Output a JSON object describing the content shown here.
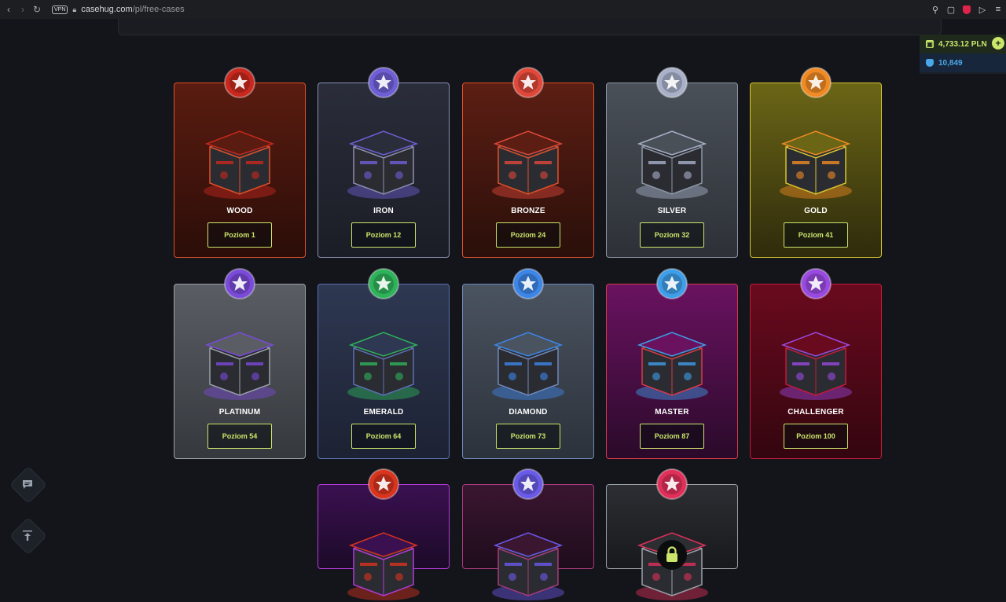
{
  "browser": {
    "vpn_label": "VPN",
    "url_domain": "casehug.com",
    "url_path": "/pl/free-cases"
  },
  "balance": {
    "money": "4,733.12 PLN",
    "points": "10,849",
    "money_icon": "wallet-icon",
    "points_icon": "shield-icon"
  },
  "cases": [
    {
      "name": "WOOD",
      "button": "Poziom 1",
      "border": "#e0502a",
      "bg1": "#5a1c10",
      "bg2": "#2b0d08",
      "medal": "#c8281e"
    },
    {
      "name": "IRON",
      "button": "Poziom 12",
      "border": "#8b8fb0",
      "bg1": "#2a2d3a",
      "bg2": "#1b1d26",
      "medal": "#6e5fd6"
    },
    {
      "name": "BRONZE",
      "button": "Poziom 24",
      "border": "#e0502a",
      "bg1": "#5c1e13",
      "bg2": "#2a0f0a",
      "medal": "#e0483a"
    },
    {
      "name": "SILVER",
      "button": "Poziom 32",
      "border": "#8f96a4",
      "bg1": "#4a5058",
      "bg2": "#2d3137",
      "medal": "#a9b1c9"
    },
    {
      "name": "GOLD",
      "button": "Poziom 41",
      "border": "#d6c32e",
      "bg1": "#6b6616",
      "bg2": "#2f2b0c",
      "medal": "#f08a24"
    },
    {
      "name": "PLATINUM",
      "button": "Poziom 54",
      "border": "#9aa0a8",
      "bg1": "#5a5e64",
      "bg2": "#35383d",
      "medal": "#7a4ad8"
    },
    {
      "name": "EMERALD",
      "button": "Poziom 64",
      "border": "#5d6fb5",
      "bg1": "#2e3852",
      "bg2": "#1d2233",
      "medal": "#2fb35a"
    },
    {
      "name": "DIAMOND",
      "button": "Poziom 73",
      "border": "#6f88b8",
      "bg1": "#4a5360",
      "bg2": "#2c323b",
      "medal": "#3d86e8"
    },
    {
      "name": "MASTER",
      "button": "Poziom 87",
      "border": "#d83a48",
      "bg1": "#6a1260",
      "bg2": "#2a0a2a",
      "medal": "#3f9ee8"
    },
    {
      "name": "CHALLENGER",
      "button": "Poziom 100",
      "border": "#c21a3a",
      "bg1": "#6a0a1e",
      "bg2": "#33060f",
      "medal": "#9a4ae0"
    },
    {
      "name": "",
      "button": "",
      "border": "#b23ad8",
      "bg1": "#3a1050",
      "bg2": "#1c0a28",
      "medal": "#d8341e"
    },
    {
      "name": "",
      "button": "",
      "border": "#a83a7a",
      "bg1": "#3a1630",
      "bg2": "#1e0c1c",
      "medal": "#6a5ae8"
    },
    {
      "name": "",
      "button": "",
      "border": "#9aa0a8",
      "bg1": "#2c2e33",
      "bg2": "#18191c",
      "medal": "#e0305a",
      "locked": true
    }
  ],
  "side": {
    "chat_icon": "chat-icon",
    "scroll_top_icon": "arrow-up-icon"
  }
}
